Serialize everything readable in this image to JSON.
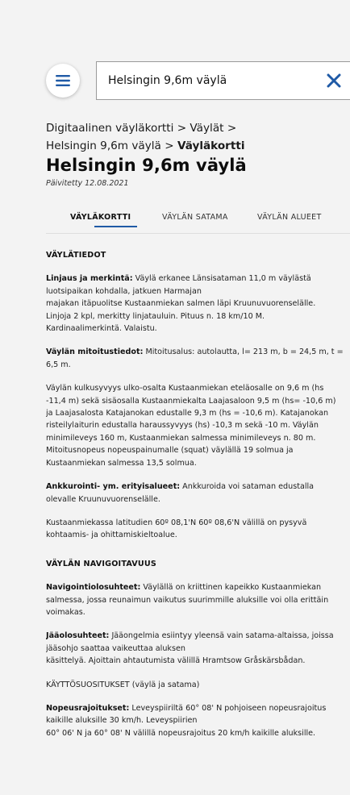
{
  "search": {
    "value": "Helsingin 9,6m väylä"
  },
  "breadcrumb": {
    "items": [
      "Digitaalinen väyläkortti",
      "Väylät",
      "Helsingin 9,6m väylä"
    ],
    "current": "Väyläkortti",
    "separator": ">"
  },
  "page": {
    "title": "Helsingin 9,6m väylä",
    "updated": "Päivitetty 12.08.2021"
  },
  "tabs": [
    {
      "label": "VÄYLÄKORTTI",
      "active": true
    },
    {
      "label": "VÄYLÄN SATAMA",
      "active": false
    },
    {
      "label": "VÄYLÄN ALUEET",
      "active": false
    }
  ],
  "sections": {
    "vaylatiedot": {
      "heading": "VÄYLÄTIEDOT",
      "linjaus": {
        "label": "Linjaus ja merkintä:",
        "lines": [
          " Väylä erkanee Länsisataman 11,0 m väylästä",
          "luotsipaikan kohdalla, jatkuen Harmajan",
          "majakan itäpuolitse Kustaanmiekan salmen läpi Kruunuvuorenselälle.",
          "Linjoja 2 kpl, merkitty linjatauluin. Pituus n. 18 km/10 M.",
          "Kardinaalimerkintä. Valaistu."
        ]
      },
      "mitoitus": {
        "label": "Väylän mitoitustiedot:",
        "lines": [
          " Mitoitusalus: autolautta, l= 213 m, b = 24,5 m, t =",
          "6,5 m."
        ]
      },
      "kulkusyvyys": {
        "lines": [
          "Väylän kulkusyvyys ulko-osalta Kustaanmiekan eteläosalle on 9,6 m (hs",
          "-11,4 m) sekä sisäosalla Kustaanmiekalta Laajasaloon 9,5 m (hs= -10,6 m)",
          "ja Laajasalosta Katajanokan edustalle 9,3 m (hs = -10,6 m). Katajanokan",
          "risteilylaiturin edustalla haraussyvyys (hs) -10,3 m sekä -10 m. Väylän",
          "minimileveys 160 m, Kustaanmiekan salmessa minimileveys n. 80 m.",
          "Mitoitusnopeus nopeuspainumalle (squat) väylällä 19 solmua ja",
          "Kustaanmiekan salmessa 13,5 solmua."
        ]
      },
      "ankkurointi": {
        "label": "Ankkurointi- ym. erityisalueet:",
        "lines": [
          " Ankkuroida voi sataman edustalla",
          "olevalle Kruunuvuorenselälle."
        ]
      },
      "kohtaamis": {
        "lines": [
          "Kustaanmiekassa latitudien 60º 08,1'N 60º 08,6'N välillä on pysyvä",
          "kohtaamis- ja ohittamiskieltoalue."
        ]
      }
    },
    "navigoitavuus": {
      "heading": "VÄYLÄN NAVIGOITAVUUS",
      "navigointiolosuhteet": {
        "label": "Navigointiolosuhteet:",
        "lines": [
          " Väylällä on kriittinen kapeikko Kustaanmiekan",
          "salmessa, jossa reunaimun vaikutus suurimmille aluksille voi olla erittäin",
          "voimakas."
        ]
      },
      "jaaolosuhteet": {
        "label": "Jääolosuhteet:",
        "lines": [
          " Jääongelmia esiintyy yleensä vain satama-altaissa, joissa",
          "jääsohjo saattaa vaikeuttaa aluksen",
          "käsittelyä. Ajoittain ahtautumista välillä Hramtsow Gråskärsbådan."
        ]
      },
      "kayttosuositukset": "KÄYTTÖSUOSITUKSET (väylä ja satama)",
      "nopeusrajoitukset": {
        "label": "Nopeusrajoitukset:",
        "lines": [
          " Leveyspiiriltä 60° 08' N pohjoiseen nopeusrajoitus",
          "kaikille aluksille 30 km/h. Leveyspiirien",
          "60° 06' N ja 60° 08' N välillä nopeusrajoitus 20 km/h kaikille aluksille."
        ]
      }
    }
  }
}
